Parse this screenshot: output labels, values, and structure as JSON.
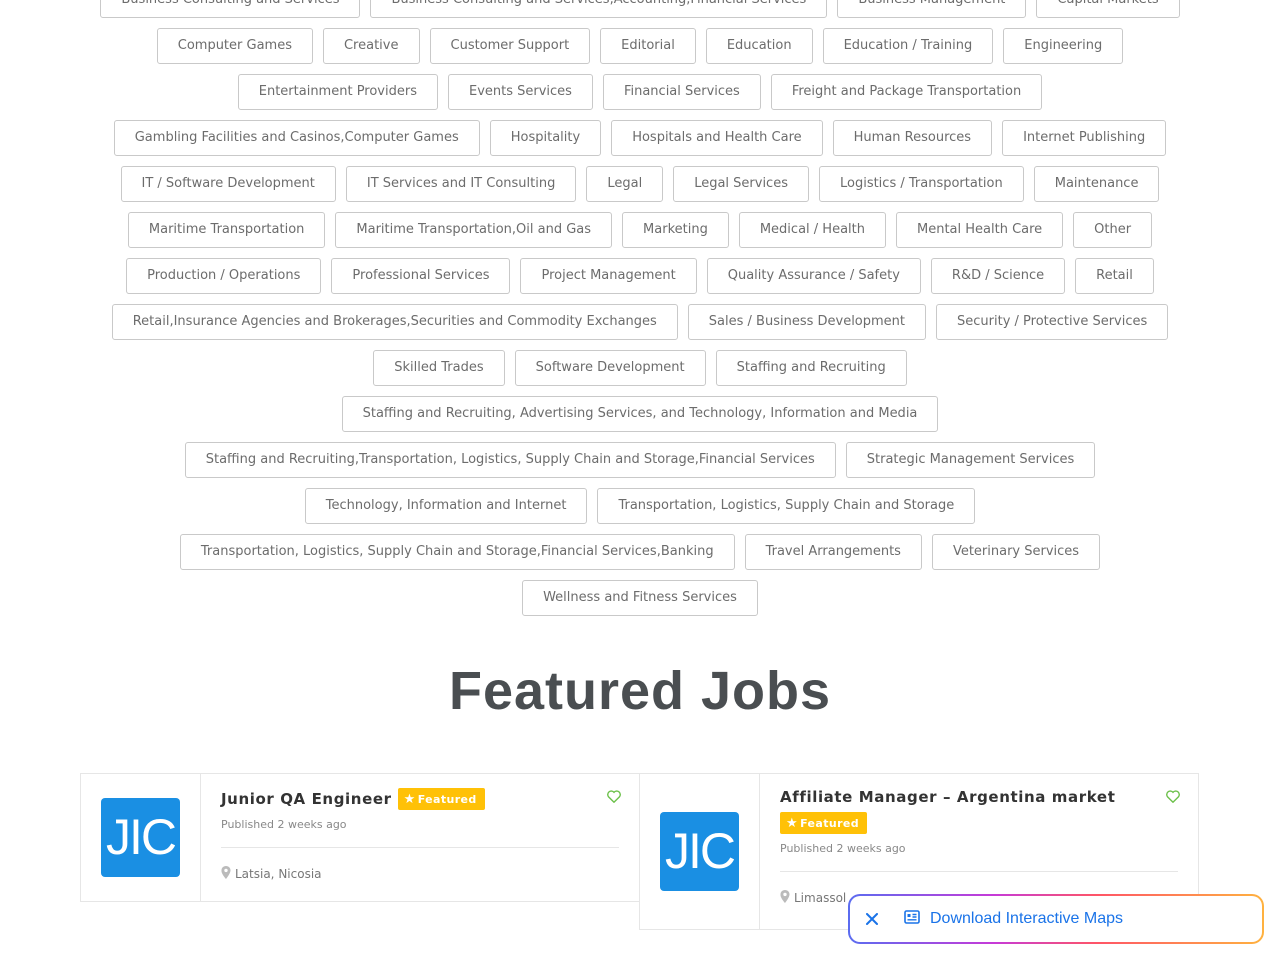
{
  "categories": [
    "Business Consulting and Services",
    "Business Consulting and Services,Accounting,Financial Services",
    "Business Management",
    "Capital Markets",
    "Computer Games",
    "Creative",
    "Customer Support",
    "Editorial",
    "Education",
    "Education / Training",
    "Engineering",
    "Entertainment Providers",
    "Events Services",
    "Financial Services",
    "Freight and Package Transportation",
    "Gambling Facilities and Casinos,Computer Games",
    "Hospitality",
    "Hospitals and Health Care",
    "Human Resources",
    "Internet Publishing",
    "IT / Software Development",
    "IT Services and IT Consulting",
    "Legal",
    "Legal Services",
    "Logistics / Transportation",
    "Maintenance",
    "Maritime Transportation",
    "Maritime Transportation,Oil and Gas",
    "Marketing",
    "Medical / Health",
    "Mental Health Care",
    "Other",
    "Production / Operations",
    "Professional Services",
    "Project Management",
    "Quality Assurance / Safety",
    "R&D / Science",
    "Retail",
    "Retail,Insurance Agencies and Brokerages,Securities and Commodity Exchanges",
    "Sales / Business Development",
    "Security / Protective Services",
    "Skilled Trades",
    "Software Development",
    "Staffing and Recruiting",
    "Staffing and Recruiting, Advertising Services, and Technology, Information and Media",
    "Staffing and Recruiting,Transportation, Logistics, Supply Chain and Storage,Financial Services",
    "Strategic Management Services",
    "Technology, Information and Internet",
    "Transportation, Logistics, Supply Chain and Storage",
    "Transportation, Logistics, Supply Chain and Storage,Financial Services,Banking",
    "Travel Arrangements",
    "Veterinary Services",
    "Wellness and Fitness Services"
  ],
  "featured_section": {
    "title": "Featured Jobs"
  },
  "jobs": [
    {
      "logo_text": "JIC",
      "title": "Junior QA Engineer",
      "badge": "Featured",
      "published": "Published 2 weeks ago",
      "location": "Latsia, Nicosia"
    },
    {
      "logo_text": "JIC",
      "title": "Affiliate Manager – Argentina market",
      "badge": "Featured",
      "published": "Published 2 weeks ago",
      "location": "Limassol"
    }
  ],
  "download_bar": {
    "label": "Download Interactive Maps"
  },
  "icons": {
    "close": "close-icon",
    "map": "map-icon",
    "heart": "heart-icon",
    "star": "star-icon",
    "pin": "location-pin-icon"
  },
  "colors": {
    "logo_bg": "#1a8fe3",
    "badge_bg": "#ffc107",
    "heart": "#6cc04a",
    "link": "#1a73e8"
  }
}
